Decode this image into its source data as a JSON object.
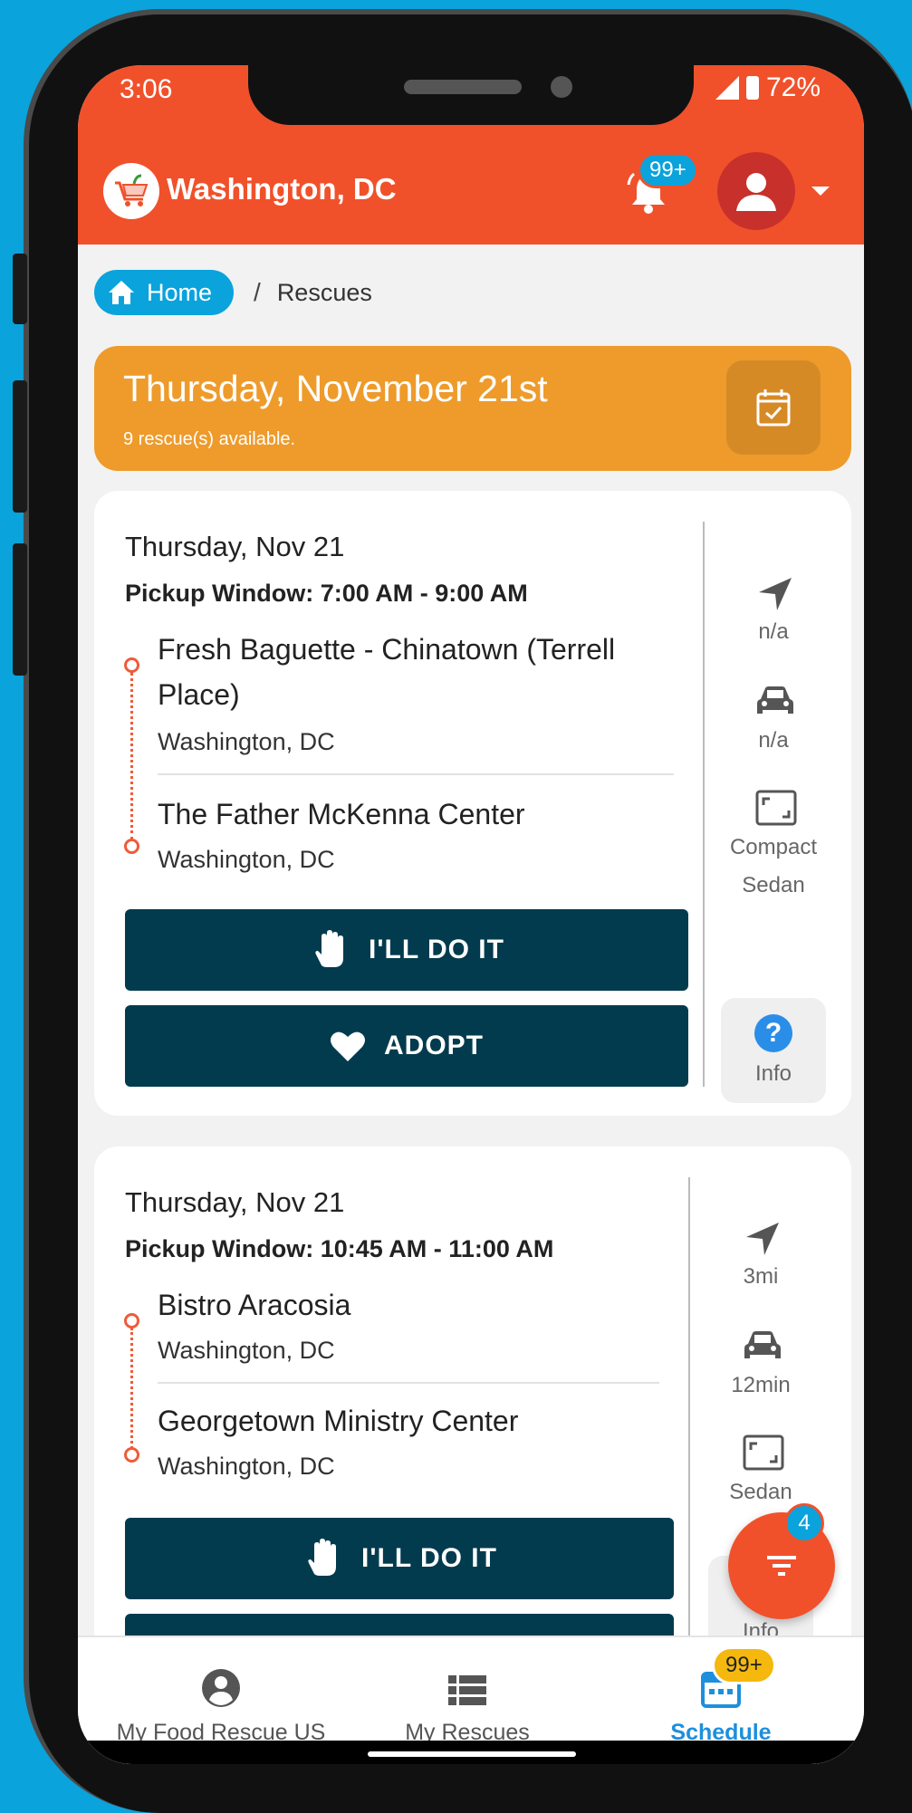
{
  "status_bar": {
    "time": "3:06",
    "battery": "72%"
  },
  "header": {
    "city": "Washington, DC",
    "notification_count": "99+"
  },
  "breadcrumb": {
    "home": "Home",
    "separator": "/",
    "current": "Rescues"
  },
  "date_banner": {
    "title": "Thursday, November 21st",
    "subtitle": "9 rescue(s) available."
  },
  "rescues": [
    {
      "date": "Thursday, Nov 21",
      "pickup_window": "Pickup Window: 7:00 AM - 9:00 AM",
      "pickup_name_line1": "Fresh Baguette - Chinatown (Terrell",
      "pickup_name_line2": "Place)",
      "pickup_city": "Washington, DC",
      "dropoff_name": "The Father McKenna Center",
      "dropoff_city": "Washington, DC",
      "distance": "n/a",
      "drive_time": "n/a",
      "vehicle_line1": "Compact",
      "vehicle_line2": "Sedan",
      "info_label": "Info",
      "do_it_label": "I'LL DO IT",
      "adopt_label": "ADOPT"
    },
    {
      "date": "Thursday, Nov 21",
      "pickup_window": "Pickup Window: 10:45 AM - 11:00 AM",
      "pickup_name": "Bistro Aracosia",
      "pickup_city": "Washington, DC",
      "dropoff_name": "Georgetown Ministry Center",
      "dropoff_city": "Washington, DC",
      "distance": "3mi",
      "drive_time": "12min",
      "vehicle": "Sedan",
      "info_label": "Info",
      "do_it_label": "I'LL DO IT"
    }
  ],
  "filter_fab": {
    "badge": "4"
  },
  "bottom_nav": {
    "items": [
      {
        "label": "My Food Rescue US",
        "icon": "account-circle-icon"
      },
      {
        "label": "My Rescues",
        "icon": "list-icon"
      },
      {
        "label": "Schedule",
        "icon": "calendar-icon",
        "badge": "99+",
        "active": true
      }
    ]
  },
  "colors": {
    "brand_orange": "#f0512b",
    "banner_amber": "#ee9b2c",
    "button_navy": "#023b4e",
    "accent_blue": "#0aa3dc"
  }
}
